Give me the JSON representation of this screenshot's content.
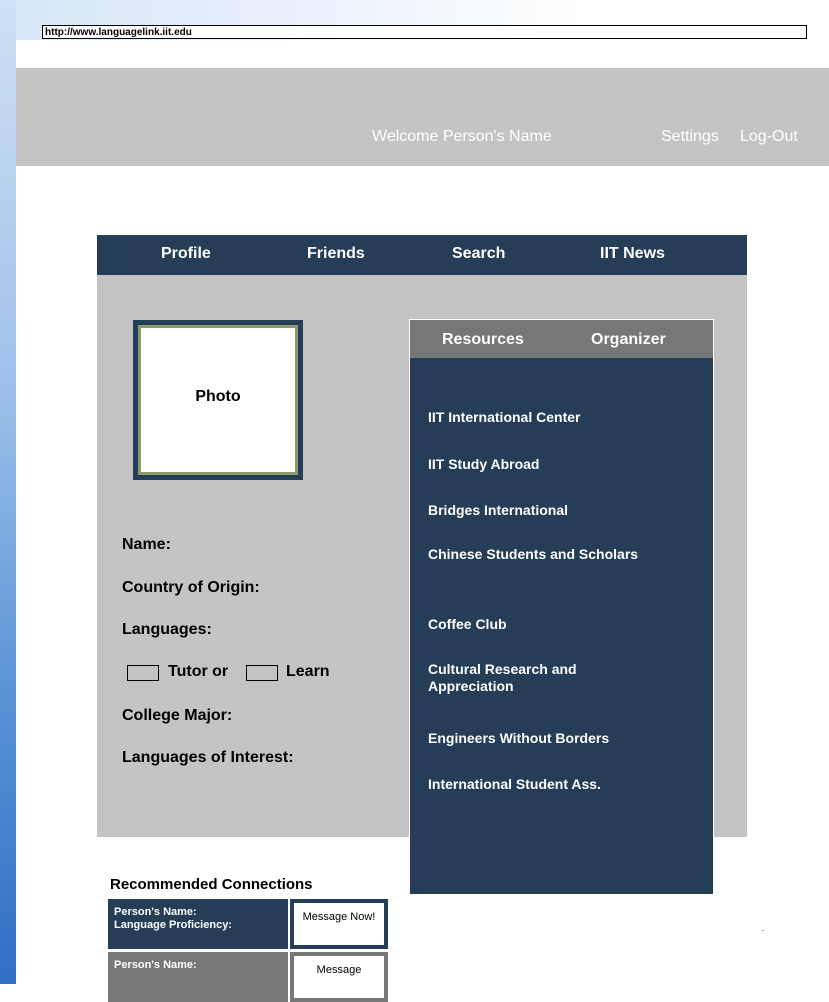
{
  "browser": {
    "url": "http://www.languagelink.iit.edu"
  },
  "header": {
    "welcome": "Welcome Person's Name",
    "settings": "Settings",
    "logout": "Log-Out"
  },
  "nav": {
    "items": [
      {
        "label": "Profile"
      },
      {
        "label": "Friends"
      },
      {
        "label": "Search"
      },
      {
        "label": "IIT News"
      }
    ]
  },
  "profile": {
    "photo": "Photo",
    "name": "Name:",
    "country": "Country of Origin:",
    "languages": "Languages:",
    "tutor": "Tutor or",
    "learn": "Learn",
    "major": "College Major:",
    "interest": "Languages of Interest:"
  },
  "resources": {
    "tabs": [
      {
        "label": "Resources"
      },
      {
        "label": "Organizer"
      }
    ],
    "items": [
      {
        "label": "IIT International Center"
      },
      {
        "label": "IIT Study Abroad"
      },
      {
        "label": "Bridges International"
      },
      {
        "label": "Chinese Students and Scholars"
      },
      {
        "label": "Coffee Club"
      },
      {
        "label": "Cultural Research and Appreciation"
      },
      {
        "label": "Engineers Without Borders"
      },
      {
        "label": "International Student Ass."
      }
    ]
  },
  "recommended": {
    "title": "Recommended Connections",
    "rows": [
      {
        "name": "Person's Name:",
        "proficiency": "Language Proficiency:",
        "button": "Message Now!",
        "color": "#253d57"
      },
      {
        "name": "Person's Name:",
        "proficiency": "",
        "button": "Message",
        "color": "#777777"
      }
    ]
  }
}
